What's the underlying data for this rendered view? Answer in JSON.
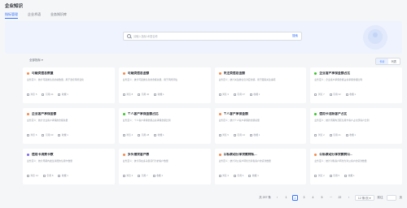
{
  "page": {
    "title": "企业知识"
  },
  "tabs": [
    {
      "label": "指标管理",
      "active": true
    },
    {
      "label": "企业术语",
      "active": false
    },
    {
      "label": "业务知识库",
      "active": false
    }
  ],
  "search": {
    "placeholder": "请输入指标/术语名称",
    "button_label": "搜索"
  },
  "filter": {
    "label": "全部指标 ▾"
  },
  "view_toggle": {
    "card_label": "卡片",
    "list_label": "列表"
  },
  "cards": [
    {
      "title": "可疑类信息数量",
      "desc": "业务定义：统计可疑类信息的总数量，用于监控风险变化",
      "dot_color": "#f5894b",
      "stat1": "浏览 5",
      "stat2": "引用 44",
      "stat3": "收藏 1"
    },
    {
      "title": "可疑类信息金额",
      "desc": "业务定义：统计可疑类信息的金额总量，用于风险评估",
      "dot_color": "#f5894b",
      "stat1": "浏览 8",
      "stat2": "引用 40",
      "stat3": "收藏 1"
    },
    {
      "title": "关注类信息金额",
      "desc": "业务定义：统计关注类信息对应金额，用于跟踪关注事项",
      "dot_color": "#f5894b",
      "stat1": "浏览 3",
      "stat2": "引用 37",
      "stat3": "收藏 1"
    },
    {
      "title": "企业客户承保金额占比",
      "desc": "业务定义：企业客户承保金额占总承保金额比例",
      "dot_color": "#34c724",
      "stat1": "浏览 7",
      "stat2": "引用 32",
      "stat3": "收藏 1"
    },
    {
      "title": "企业客户承保金额",
      "desc": "业务定义：统计企业客户承保的金额总量",
      "dot_color": "#f5894b",
      "stat1": "浏览 6",
      "stat2": "引用 30",
      "stat3": "收藏 1"
    },
    {
      "title": "个人客户承保金额占比",
      "desc": "业务定义：个人客户承保金额占总承保金额比例",
      "dot_color": "#34c724",
      "stat1": "浏览 4",
      "stat2": "引用 28",
      "stat3": "收藏 1"
    },
    {
      "title": "个人客户承保金额",
      "desc": "业务定义：统计个人客户承保的金额总量",
      "dot_color": "#f5894b",
      "stat1": "浏览 5",
      "stat2": "引用 24",
      "stat3": "收藏 1"
    },
    {
      "title": "信用卡活跃客户占比",
      "desc": "业务定义：统计周期内活跃信用卡客户占全部客户比例",
      "dot_color": "#34c724",
      "stat1": "浏览 2",
      "stat2": "引用 21",
      "stat3": "收藏 1"
    },
    {
      "title": "信用卡消费卡数",
      "desc": "业务定义：统计周期内发生消费的信用卡数量",
      "dot_color": "#7b67ee",
      "stat1": "浏览 14",
      "stat2": "引用 8",
      "stat3": "收藏 1"
    },
    {
      "title": "多头借贷客户数",
      "desc": "业务定义：统计存在多头借贷行为的客户数量",
      "dot_color": "#f5894b",
      "stat1": "浏览 4",
      "stat2": "引用 7",
      "stat3": "收藏 1"
    },
    {
      "title": "公私联动分享贷款转私...",
      "desc": "业务定义：统计对公客户转化为对私客户的贷款数量",
      "dot_color": "#f5894b",
      "stat1": "浏览 3",
      "stat2": "引用 6",
      "stat3": "收藏 1"
    },
    {
      "title": "公私联动分享贷款转公...",
      "desc": "业务定义：统计对私客户转化为对公客户的贷款数量",
      "dot_color": "#f5894b",
      "stat1": "浏览 2",
      "stat2": "引用 5",
      "stat3": "收藏 1"
    }
  ],
  "pagination": {
    "total": "共 297 条",
    "prev": "‹",
    "pages": [
      "1",
      "2",
      "3",
      "4",
      "5",
      "···",
      "22"
    ],
    "current": "2",
    "next": "›",
    "page_size": "12 条/页 ▾",
    "jump_label": "前往",
    "jump_suffix": "页"
  }
}
